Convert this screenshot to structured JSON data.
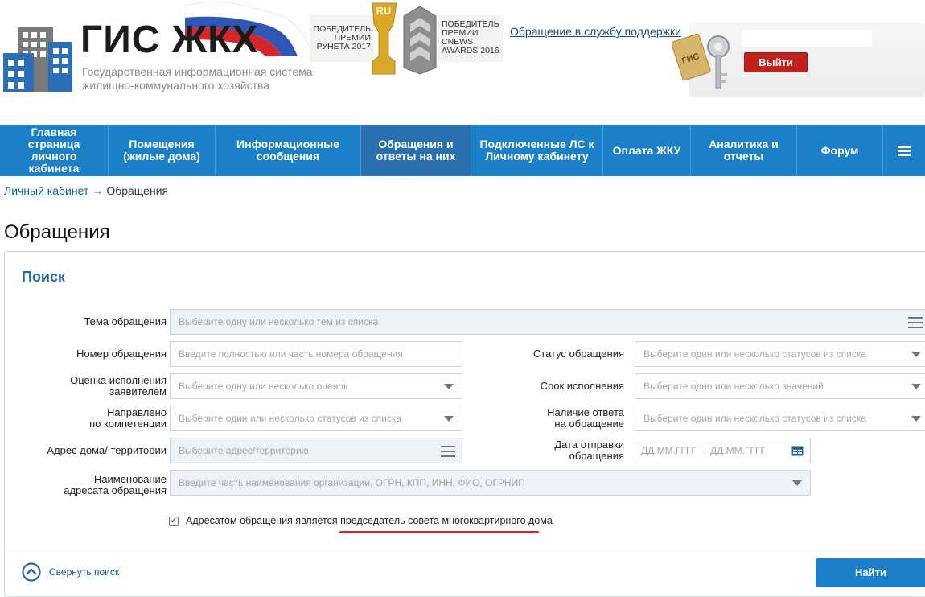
{
  "header": {
    "logo_title": "ГИС ЖКХ",
    "logo_subtitle": "Государственная информационная система жилищно-коммунального хозяйства",
    "award_runet": "ПОБЕДИТЕЛЬ\nПРЕМИИ\nРУНЕТА 2017",
    "award_cnews": "ПОБЕДИТЕЛЬ\nПРЕМИИ\nCNEWS\nAWARDS 2016",
    "trophy_text": "RU",
    "support_link": "Обращение в службу поддержки",
    "logout_label": "Выйти"
  },
  "nav": {
    "items": [
      {
        "label": "Главная\nстраница\nличного\nкабинета"
      },
      {
        "label": "Помещения\n(жилые дома)"
      },
      {
        "label": "Информационные\nсообщения"
      },
      {
        "label": "Обращения и\nответы на них"
      },
      {
        "label": "Подключенные ЛС к\nЛичному кабинету"
      },
      {
        "label": "Оплата ЖКУ"
      },
      {
        "label": "Аналитика и\nотчеты"
      },
      {
        "label": "Форум"
      }
    ],
    "active_index": 3
  },
  "breadcrumb": {
    "home": "Личный кабинет",
    "arrow": "→",
    "current": "Обращения"
  },
  "page_title": "Обращения",
  "search": {
    "title": "Поиск",
    "fields": {
      "topic": {
        "label": "Тема обращения",
        "placeholder": "Выберите одну или несколько тем из списка"
      },
      "number": {
        "label": "Номер обращения",
        "placeholder": "Введите полностью или часть номера обращения"
      },
      "status": {
        "label": "Статус обращения",
        "placeholder": "Выберите один или несколько статусов из списка"
      },
      "rating": {
        "label": "Оценка исполнения\nзаявителем",
        "placeholder": "Выберите одну или несколько оценок"
      },
      "deadline": {
        "label": "Срок исполнения",
        "placeholder": "Выберите одно или несколько значений"
      },
      "competence": {
        "label": "Направлено\nпо компетенции",
        "placeholder": "Выберите один или несколько статусов из списка"
      },
      "answer": {
        "label": "Наличие ответа\nна обращение",
        "placeholder": "Выберите один или несколько статусов из списка"
      },
      "address": {
        "label": "Адрес дома/ территории",
        "placeholder": "Выберите адрес/территорию"
      },
      "send_date": {
        "label": "Дата отправки\nобращения",
        "from_placeholder": "ДД.ММ.ГГГГ",
        "separator": "-",
        "to_placeholder": "ДД.ММ.ГГГГ"
      },
      "addressee": {
        "label": "Наименование\nадресата обращения",
        "placeholder": "Введите часть наименования организации, ОГРН, КПП, ИНН, ФИО, ОГРНИП"
      }
    },
    "checkbox": {
      "checked": true,
      "mark": "✓",
      "label": "Адресатом обращения является председатель совета многоквартирного дома"
    },
    "collapse_label": "Свернуть поиск",
    "find_label": "Найти"
  },
  "colors": {
    "nav_bg": "#1c80c8",
    "nav_active": "#2a6fae",
    "logout_red": "#c0221b",
    "accent_blue": "#246aa7",
    "highlight_red": "#d6202a"
  },
  "icons": {
    "logo": "building-icon",
    "menu": "hamburger-icon",
    "list": "list-icon",
    "dropdown": "chevron-down-icon",
    "calendar": "calendar-icon",
    "collapse": "chevron-up-circle-icon",
    "keys": "keys-icon"
  }
}
